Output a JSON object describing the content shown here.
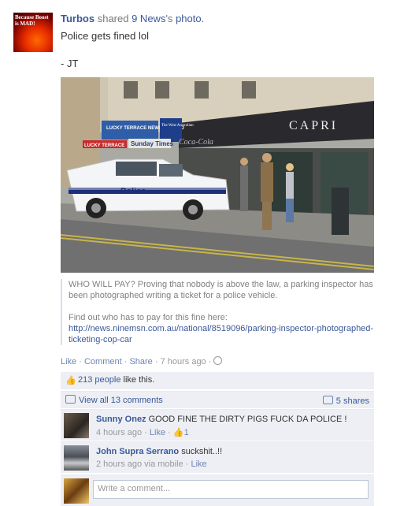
{
  "post": {
    "avatar_text": "Because Boost is MAD!",
    "author": "Turbos",
    "verb": "shared",
    "source_page": "9 News",
    "source_suffix": "'s",
    "object": "photo.",
    "message": "Police gets fined lol",
    "signature": "- JT"
  },
  "photo": {
    "sign_capri": "CAPRI",
    "sign_lucky": "LUCKY TERRACE NEWS & LOTTO",
    "sign_sunday": "Sunday Times",
    "sign_west": "The West Australian",
    "sign_lucky_small": "LUCKY TERRACE",
    "sign_coke": "Coca-Cola",
    "vehicle_text": "Police"
  },
  "attachment": {
    "caption": "WHO WILL PAY? Proving that nobody is above the law, a parking inspector has been photographed writing a ticket for a police vehicle.",
    "find_out": "Find out who has to pay for this fine here:",
    "link": "http://news.ninemsn.com.au/national/8519096/parking-inspector-photographed-ticketing-cop-car"
  },
  "actions": {
    "like": "Like",
    "comment": "Comment",
    "share": "Share",
    "time": "7 hours ago"
  },
  "ufi": {
    "likes_count": "213 people",
    "likes_suffix": "like this.",
    "view_all": "View all 13 comments",
    "shares": "5 shares"
  },
  "comments": [
    {
      "author": "Sunny Onez",
      "text": "GOOD FINE THE DIRTY PIGS FUCK DA POLICE !",
      "time": "4 hours ago",
      "like": "Like",
      "likes": "1"
    },
    {
      "author": "John Supra Serrano",
      "text": "suckshit..!!",
      "time": "2 hours ago via mobile",
      "like": "Like"
    }
  ],
  "composer": {
    "placeholder": "Write a comment..."
  },
  "colors": {
    "link": "#3b5998",
    "ufi_bg": "#edeff4"
  }
}
